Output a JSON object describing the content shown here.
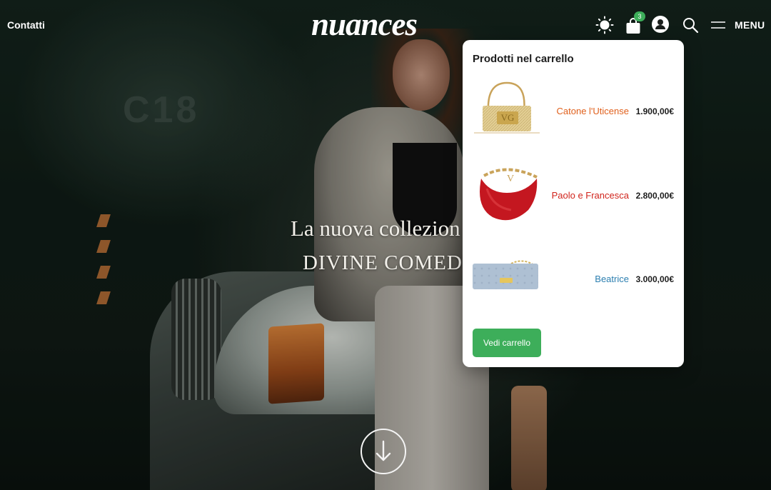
{
  "header": {
    "contact_label": "Contatti",
    "logo_text": "nuances",
    "cart_count": "3",
    "menu_label": "MENU",
    "icons": [
      "sun-icon",
      "shopping-bag-icon",
      "user-icon",
      "search-icon",
      "hamburger-icon"
    ]
  },
  "hero": {
    "title": "La nuova collezion",
    "subtitle": "DIVINE COMEDY",
    "wall_sign": "C18"
  },
  "cart": {
    "title": "Prodotti nel carrello",
    "items": [
      {
        "name": "Catone l'Uticense",
        "price": "1.900,00€",
        "name_color": "#e0601c",
        "image": "beige-straw-handbag"
      },
      {
        "name": "Paolo e Francesca",
        "price": "2.800,00€",
        "name_color": "#d1241c",
        "image": "red-hobo-bag"
      },
      {
        "name": "Beatrice",
        "price": "3.000,00€",
        "name_color": "#2c7fb0",
        "image": "light-blue-wallet-bag"
      }
    ],
    "view_cart_label": "Vedi carrello"
  },
  "colors": {
    "accent_green": "#3dae5a",
    "text_dark": "#1c1c1c",
    "header_text": "#ffffff"
  }
}
